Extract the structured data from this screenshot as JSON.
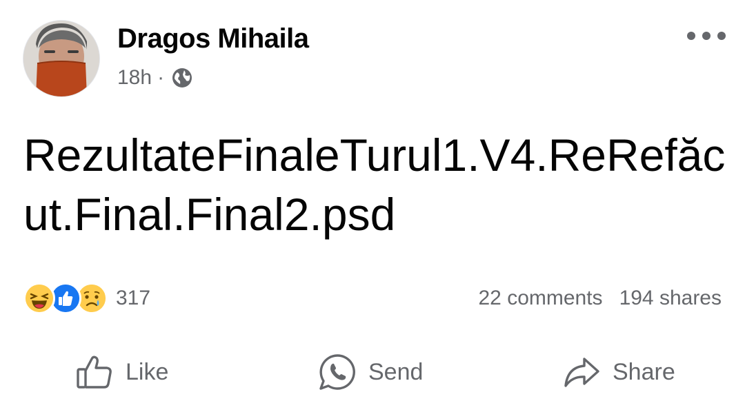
{
  "post": {
    "author": "Dragos Mihaila",
    "time": "18h",
    "separator": "·",
    "privacy_icon": "globe-icon",
    "text": "RezultateFinaleTurul1.V4.ReRefăcut.Final.Final2.psd"
  },
  "stats": {
    "reaction_icons": [
      "haha-reaction-icon",
      "like-reaction-icon",
      "sad-reaction-icon"
    ],
    "reaction_count": "317",
    "comments": "22 comments",
    "shares": "194 shares"
  },
  "actions": {
    "like": "Like",
    "send": "Send",
    "share": "Share"
  },
  "colors": {
    "text": "#050505",
    "secondary": "#65676b",
    "like_blue": "#1877f2",
    "emoji_yellow": "#ffcc4d"
  }
}
